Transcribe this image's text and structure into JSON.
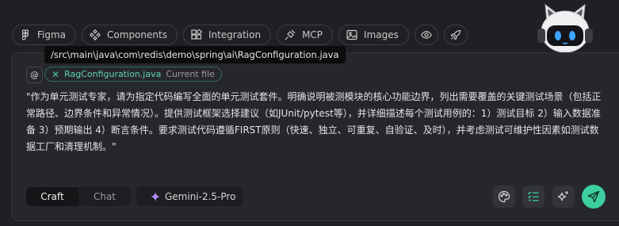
{
  "toolbar": {
    "figma": "Figma",
    "components": "Components",
    "integration": "Integration",
    "mcp": "MCP",
    "images": "Images"
  },
  "tooltip": "/src\\main\\java\\com\\redis\\demo\\spring\\ai\\RagConfiguration.java",
  "context": {
    "at_symbol": "@",
    "file_name": "RagConfiguration.java",
    "file_tag": "Current file"
  },
  "prompt": "\"作为单元测试专家，请为指定代码编写全面的单元测试套件。明确说明被测模块的核心功能边界，列出需要覆盖的关键测试场景（包括正常路径、边界条件和异常情况）。提供测试框架选择建议（如JUnit/pytest等），并详细描述每个测试用例的：1）测试目标 2）输入数据准备 3）预期输出 4）断言条件。要求测试代码遵循FIRST原则（快速、独立、可重复、自验证、及时），并考虑测试可维护性因素如测试数据工厂和清理机制。\"",
  "modes": {
    "craft": "Craft",
    "chat": "Chat"
  },
  "model": "Gemini-2.5-Pro",
  "colors": {
    "accent": "#3ccf9f",
    "background": "#1f2023",
    "panel": "#26272b"
  }
}
